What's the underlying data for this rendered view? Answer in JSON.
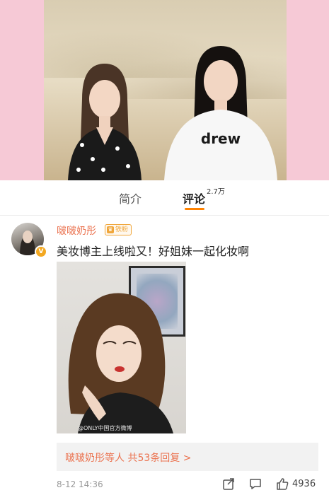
{
  "tabs": {
    "intro_label": "简介",
    "comments_label": "评论",
    "comments_count": "2.7万"
  },
  "comment": {
    "username": "啵啵奶彤",
    "fan_badge": "铁粉",
    "text": "美妆博主上线啦又！好姐妹一起化妆啊",
    "photo_watermark": "@ONLY中国官方微博",
    "replies_text": "啵啵奶彤等人 共53条回复 >",
    "time": "8-12 14:36",
    "like_count": "4936"
  },
  "video": {
    "shirt_text": "drew"
  },
  "colors": {
    "accent_orange": "#ff8200",
    "username_color": "#eb7350",
    "reply_bg": "#f2f2f2"
  },
  "icons": [
    "verified-icon",
    "crown-icon",
    "share-icon",
    "comment-icon",
    "like-icon"
  ]
}
